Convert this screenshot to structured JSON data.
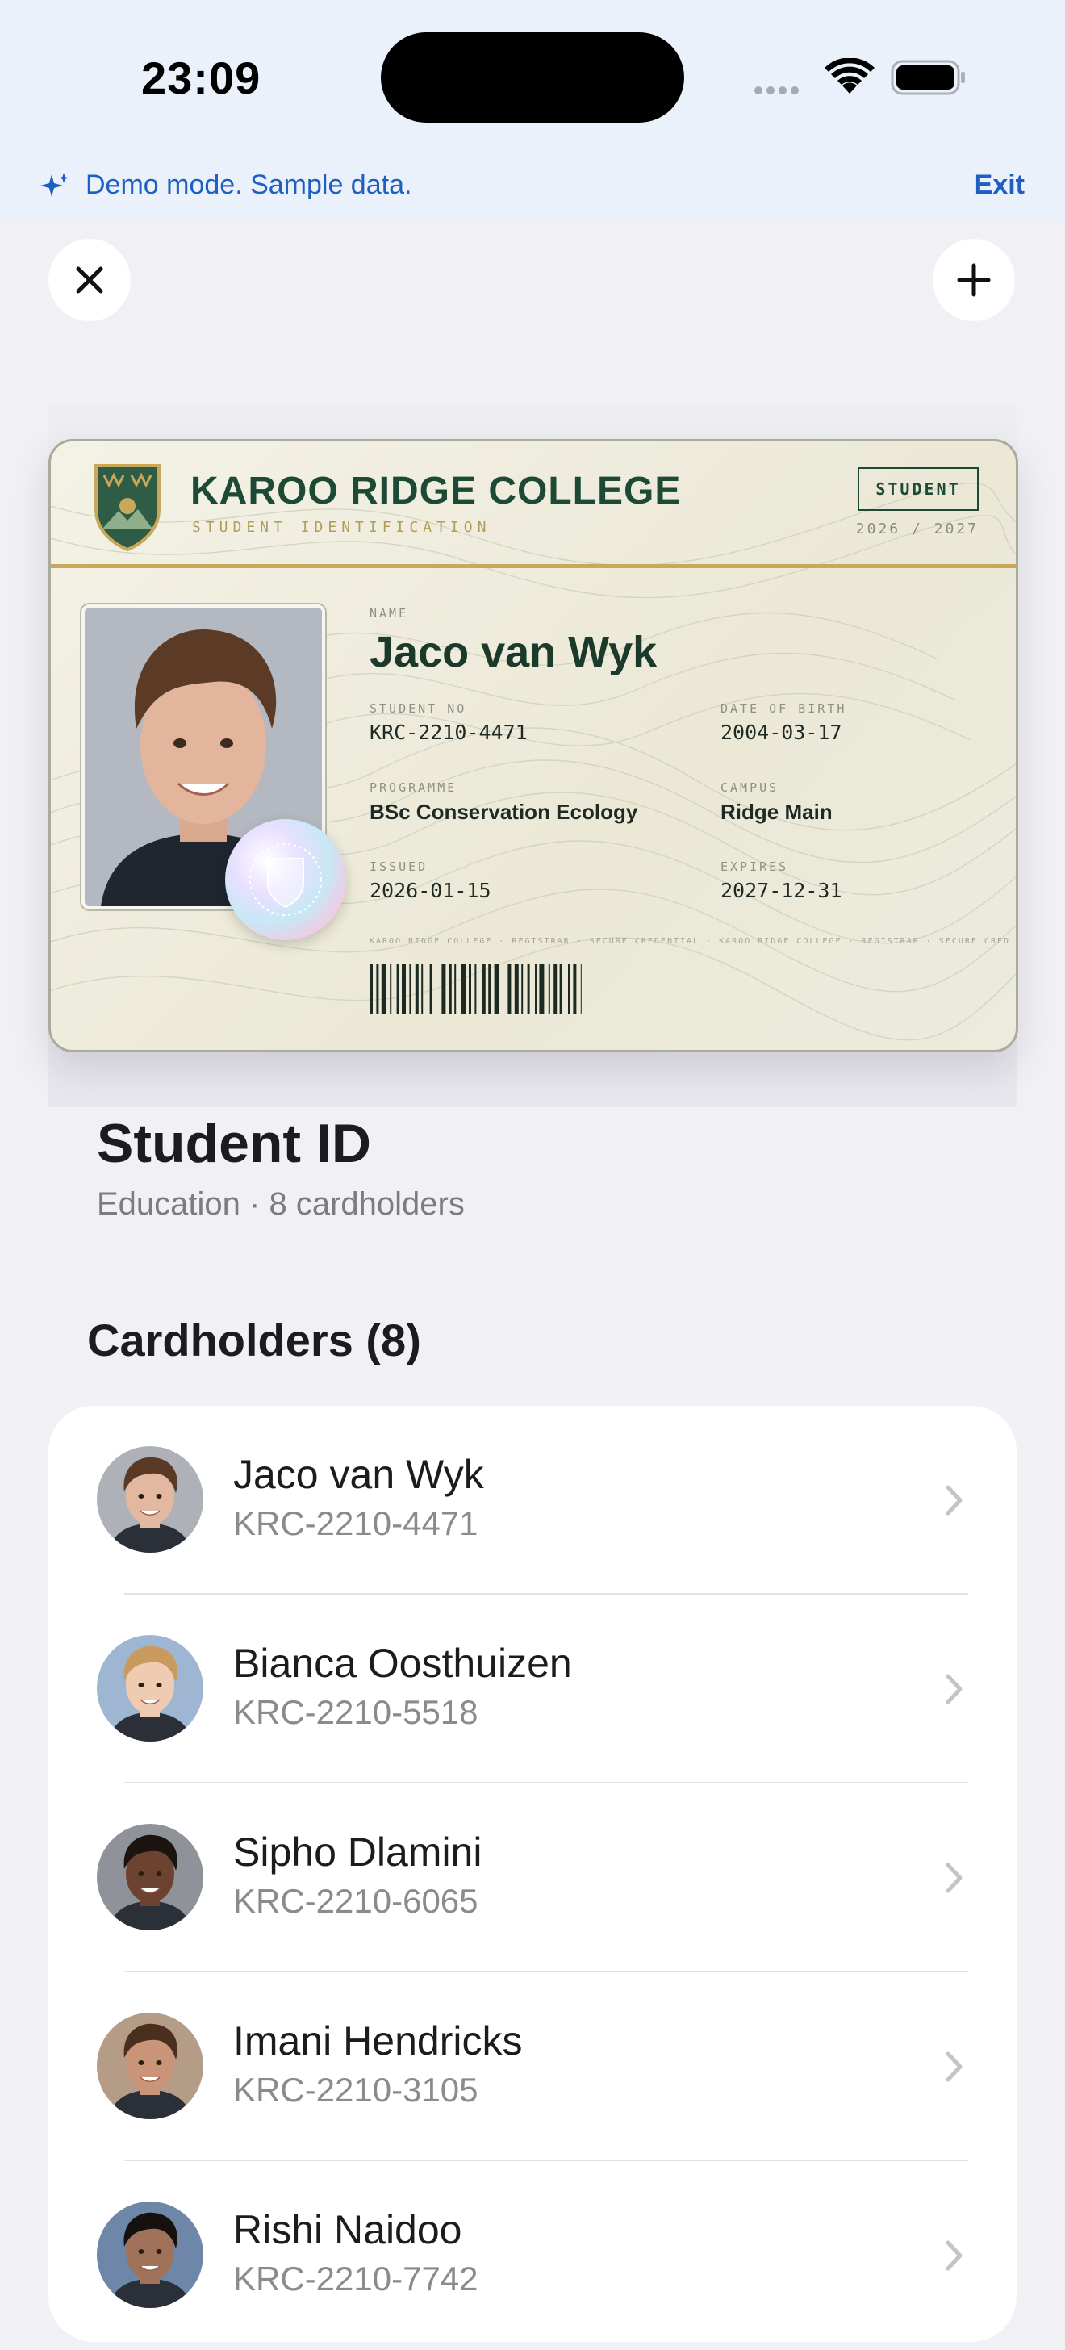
{
  "status_bar": {
    "time": "23:09"
  },
  "demo_banner": {
    "text": "Demo mode. Sample data.",
    "exit_label": "Exit"
  },
  "card": {
    "college": "KAROO RIDGE COLLEGE",
    "subtitle": "STUDENT IDENTIFICATION",
    "badge": "STUDENT",
    "academic_year": "2026 / 2027",
    "name_label": "NAME",
    "name": "Jaco van Wyk",
    "student_no_label": "STUDENT NO",
    "student_no": "KRC-2210-4471",
    "dob_label": "DATE OF BIRTH",
    "dob": "2004-03-17",
    "programme_label": "PROGRAMME",
    "programme": "BSc Conservation Ecology",
    "campus_label": "CAMPUS",
    "campus": "Ridge Main",
    "issued_label": "ISSUED",
    "issued": "2026-01-15",
    "expires_label": "EXPIRES",
    "expires": "2027-12-31",
    "microprint": "KAROO RIDGE COLLEGE · REGISTRAR · SECURE CREDENTIAL · KAROO RIDGE COLLEGE · REGISTRAR · SECURE CRED"
  },
  "header": {
    "title": "Student ID",
    "subtitle": "Education · 8 cardholders"
  },
  "cardholders": {
    "title": "Cardholders (8)",
    "items": [
      {
        "name": "Jaco van Wyk",
        "id": "KRC-2210-4471",
        "skin": "#e2b8a0",
        "hair": "#5a3a24",
        "bg": "#aeb2b8"
      },
      {
        "name": "Bianca Oosthuizen",
        "id": "KRC-2210-5518",
        "skin": "#efcbb2",
        "hair": "#c99a5e",
        "bg": "#9fb6d2"
      },
      {
        "name": "Sipho Dlamini",
        "id": "KRC-2210-6065",
        "skin": "#6b4330",
        "hair": "#1c1410",
        "bg": "#8f9399"
      },
      {
        "name": "Imani Hendricks",
        "id": "KRC-2210-3105",
        "skin": "#c99478",
        "hair": "#4a2e1e",
        "bg": "#b59c86"
      },
      {
        "name": "Rishi Naidoo",
        "id": "KRC-2210-7742",
        "skin": "#a0725a",
        "hair": "#15110f",
        "bg": "#6e86a8"
      }
    ]
  },
  "colors": {
    "accent_blue": "#1f5fbf",
    "card_green": "#1d4a37",
    "card_gold": "#c9a85a",
    "background": "#f1f0f5"
  }
}
